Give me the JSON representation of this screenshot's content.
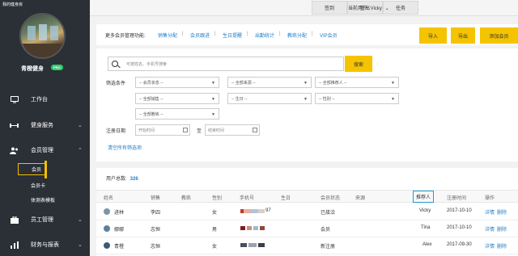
{
  "brand": "我的健身房",
  "shop": {
    "name": "青橙健身",
    "badge": "PRO"
  },
  "nav": {
    "workbench": "工作台",
    "fitness": "健身服务",
    "members": "会员管理",
    "sub_member": "会员",
    "sub_card": "会员卡",
    "sub_template": "体测表模板",
    "staff": "员工管理",
    "finance": "财务与报表"
  },
  "topbar": {
    "signin": "签到",
    "signout": "签出",
    "task": "任务",
    "user_label": "当前用户:",
    "user_name": "Vicky"
  },
  "toolbar": {
    "title": "更多会员管理功能:",
    "links": [
      "销售分配",
      "会员跟进",
      "生日提醒",
      "出勤统计",
      "教练分配",
      "VIP会员"
    ],
    "import": "导入",
    "export": "导出",
    "add": "添加会员"
  },
  "search": {
    "placeholder": "可按姓名、手机号搜索",
    "button": "搜索"
  },
  "filters": {
    "label": "筛选条件",
    "status": "-- 会员状态 --",
    "source": "-- 全部来源 --",
    "referrer": "-- 全部推荐人 --",
    "sales": "-- 全部销售 --",
    "birthday": "-- 生日 --",
    "gender": "-- 性别 --",
    "coach": "-- 全部教练 --",
    "date_label": "注册日期",
    "start": "开始时间",
    "to": "至",
    "end": "结束时间",
    "clear": "清空所有筛选项"
  },
  "summary": {
    "label": "用户总数:",
    "count": "326"
  },
  "table": {
    "headers": [
      "姓名",
      "销售",
      "教练",
      "性别",
      "手机号",
      "生日",
      "会员状态",
      "来源",
      "推荐人",
      "注册时间",
      "操作"
    ],
    "rows": [
      {
        "name": "进林",
        "sales": "李四",
        "gender": "女",
        "phone_tail": "97",
        "status": "已接洽",
        "referrer": "Vicky",
        "date": "2017-10-10"
      },
      {
        "name": "娜娜",
        "sales": "志恒",
        "gender": "男",
        "phone_tail": "",
        "status": "会员",
        "referrer": "Tina",
        "date": "2017-10-10"
      },
      {
        "name": "青橙",
        "sales": "志恒",
        "gender": "女",
        "phone_tail": "",
        "status": "新注册",
        "referrer": "Alex",
        "date": "2017-09-30"
      }
    ],
    "action_detail": "详情",
    "action_delete": "删除"
  },
  "colors": {
    "accent": "#f5c400",
    "link": "#1e7ec8",
    "sidebar": "#2b2f36",
    "badge": "#2ecc71"
  }
}
